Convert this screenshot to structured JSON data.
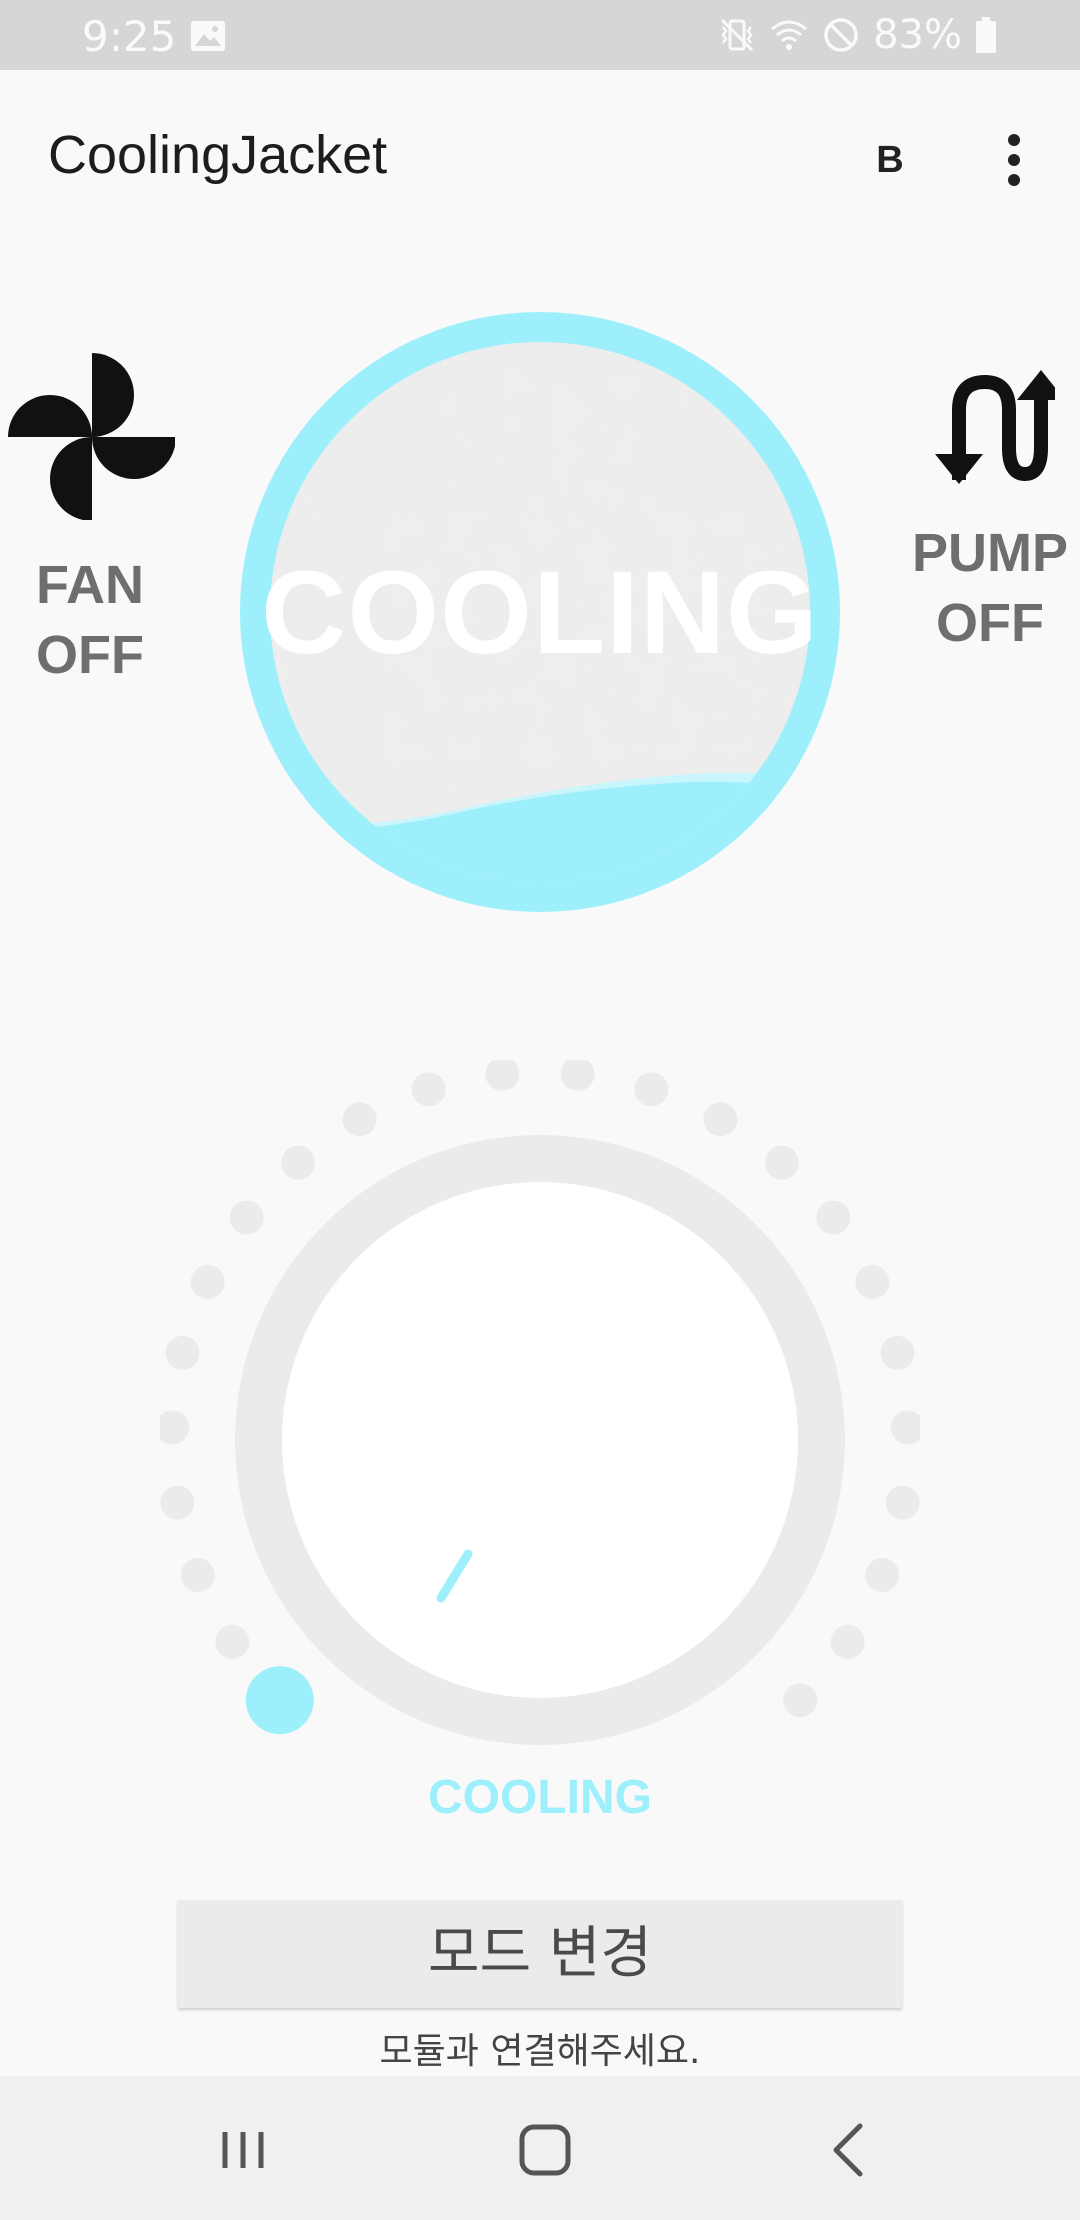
{
  "status_bar": {
    "time": "9:25",
    "battery": "83%",
    "icons": [
      "gallery-icon",
      "vibrate-mute-icon",
      "wifi-icon",
      "do-not-disturb-icon",
      "battery-icon"
    ]
  },
  "app_bar": {
    "title": "CoolingJacket",
    "b_label": "B",
    "overflow_icon": "more-vert-icon"
  },
  "fan": {
    "icon": "fan-icon",
    "label_line1": "FAN",
    "label_line2": "OFF"
  },
  "pump": {
    "icon": "pump-flow-icon",
    "label_line1": "PUMP",
    "label_line2": "OFF"
  },
  "mode_display": {
    "text": "COOLING",
    "accent_color": "#9df0fb"
  },
  "dial": {
    "mode_label": "COOLING",
    "level": 0,
    "tick_count": 24
  },
  "mode_button": {
    "label": "모드 변경"
  },
  "message": "모듈과 연결해주세요.",
  "nav_bar": {
    "icons": [
      "recent-apps-icon",
      "home-icon",
      "back-icon"
    ]
  },
  "colors": {
    "accent": "#9df0fb",
    "background": "#f9f9f9",
    "label_gray": "#6e6e6e"
  }
}
